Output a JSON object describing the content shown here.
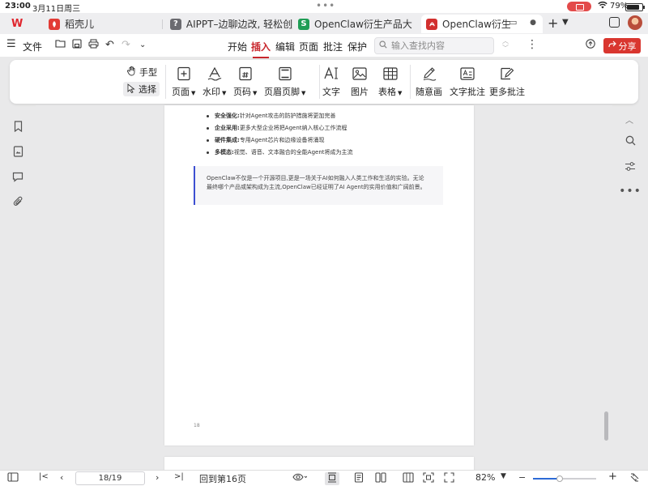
{
  "status": {
    "time": "23:00",
    "date": "3月11日周三",
    "battery": "79%"
  },
  "tabs": {
    "wps_label": "W",
    "items": [
      {
        "label": "稻壳儿"
      },
      {
        "label": "AIPPT–边聊边改, 轻松创"
      },
      {
        "label": "OpenClaw衍生产品大"
      },
      {
        "label": "OpenClaw衍生产"
      }
    ]
  },
  "menu": {
    "file": "文件",
    "tabs": [
      "开始",
      "插入",
      "编辑",
      "页面",
      "批注",
      "保护"
    ],
    "active_tab": "插入",
    "search_placeholder": "输入查找内容",
    "share": "分享"
  },
  "ribbon": {
    "hand": "手型",
    "select": "选择",
    "tools": [
      {
        "label": "页面",
        "dropdown": true,
        "icon": "page-plus-icon"
      },
      {
        "label": "水印",
        "dropdown": true,
        "icon": "watermark-icon"
      },
      {
        "label": "页码",
        "dropdown": true,
        "icon": "page-number-icon"
      },
      {
        "label": "页眉页脚",
        "dropdown": true,
        "icon": "header-footer-icon"
      },
      {
        "label": "文字",
        "dropdown": false,
        "icon": "text-icon"
      },
      {
        "label": "图片",
        "dropdown": false,
        "icon": "image-icon"
      },
      {
        "label": "表格",
        "dropdown": true,
        "icon": "table-icon"
      },
      {
        "label": "随意画",
        "dropdown": false,
        "icon": "pen-icon"
      },
      {
        "label": "文字批注",
        "dropdown": false,
        "icon": "text-comment-icon"
      },
      {
        "label": "更多批注",
        "dropdown": false,
        "icon": "more-comment-icon"
      }
    ]
  },
  "document": {
    "bullets": [
      {
        "bold": "安全强化:",
        "text": "针对Agent攻击的防护措施将更加完善"
      },
      {
        "bold": "企业采用:",
        "text": "更多大型企业将把Agent纳入核心工作流程"
      },
      {
        "bold": "硬件集成:",
        "text": "专用Agent芯片和边缘设备将涌现"
      },
      {
        "bold": "多模态:",
        "text": "视觉、语音、文本融合的全能Agent将成为主流"
      }
    ],
    "quote_line1": "OpenClaw不仅是一个开源项目,更是一场关于AI如何融入人类工作和生活的实验。无论",
    "quote_line2": "最终哪个产品或架构成为主流,OpenClaw已经证明了AI Agent的实用价值和广阔前景。",
    "page_number": "18"
  },
  "bottom": {
    "page_indicator": "18/19",
    "goto": "回到第16页",
    "zoom": "82%",
    "zoom_level": 0.42
  }
}
